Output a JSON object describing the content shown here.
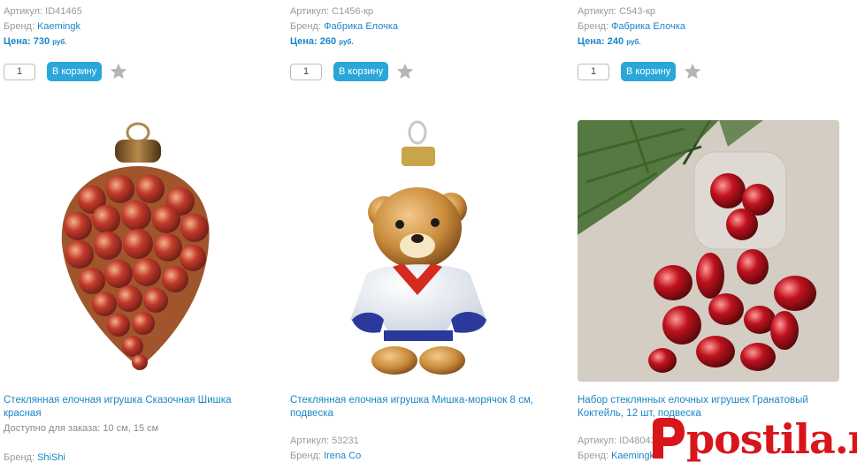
{
  "labels": {
    "article": "Артикул:",
    "brand": "Бренд:",
    "price": "Цена:",
    "currency": "руб.",
    "cart_button": "В корзину",
    "qty_default": "1"
  },
  "top_row": [
    {
      "article": "ID41465",
      "brand": "Kaemingk",
      "price": "730"
    },
    {
      "article": "C1456-кр",
      "brand": "Фабрика Елочка",
      "price": "260"
    },
    {
      "article": "C543-кр",
      "brand": "Фабрика Елочка",
      "price": "240"
    }
  ],
  "products": [
    {
      "title": "Стеклянная елочная игрушка Сказочная Шишка красная",
      "availability": "Доступно для заказа: 10 см, 15 см",
      "brand": "ShiShi",
      "image_icon": "pinecone-ornament-image"
    },
    {
      "title": "Стеклянная елочная игрушка Мишка-морячок 8 см, подвеска",
      "article": "53231",
      "brand": "Irena Co",
      "image_icon": "bear-ornament-image"
    },
    {
      "title": "Набор стеклянных елочных игрушек Гранатовый Коктейль, 12 шт, подвеска",
      "article": "ID48043",
      "brand": "Kaemingk",
      "image_icon": "ornament-set-image"
    }
  ],
  "watermark": {
    "text": "postila.ru",
    "icon": "postila-logo-icon",
    "color": "#d7151b"
  },
  "colors": {
    "link": "#1a86c8",
    "button": "#2aa7d9",
    "muted": "#9a9a9a"
  }
}
